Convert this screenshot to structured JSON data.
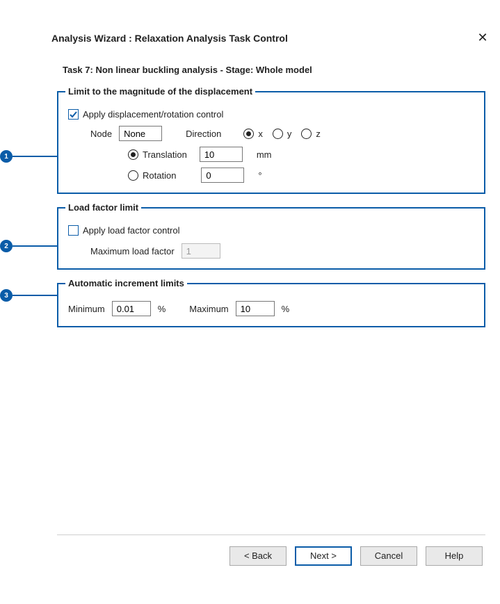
{
  "title": "Analysis Wizard : Relaxation Analysis Task Control",
  "subtitle": "Task 7: Non linear buckling analysis   -  Stage: Whole model",
  "callouts": {
    "c1": "1",
    "c2": "2",
    "c3": "3"
  },
  "group1": {
    "legend": "Limit to the magnitude of the displacement",
    "apply_label": "Apply displacement/rotation control",
    "node_label": "Node",
    "node_value": "None",
    "direction_label": "Direction",
    "dir_x": "x",
    "dir_y": "y",
    "dir_z": "z",
    "translation_label": "Translation",
    "translation_value": "10",
    "translation_unit": "mm",
    "rotation_label": "Rotation",
    "rotation_value": "0",
    "rotation_unit": "°"
  },
  "group2": {
    "legend": "Load factor limit",
    "apply_label": "Apply load factor control",
    "max_label": "Maximum load factor",
    "max_value": "1"
  },
  "group3": {
    "legend": "Automatic increment limits",
    "min_label": "Minimum",
    "min_value": "0.01",
    "min_unit": "%",
    "max_label": "Maximum",
    "max_value": "10",
    "max_unit": "%"
  },
  "buttons": {
    "back": "< Back",
    "next": "Next >",
    "cancel": "Cancel",
    "help": "Help"
  }
}
